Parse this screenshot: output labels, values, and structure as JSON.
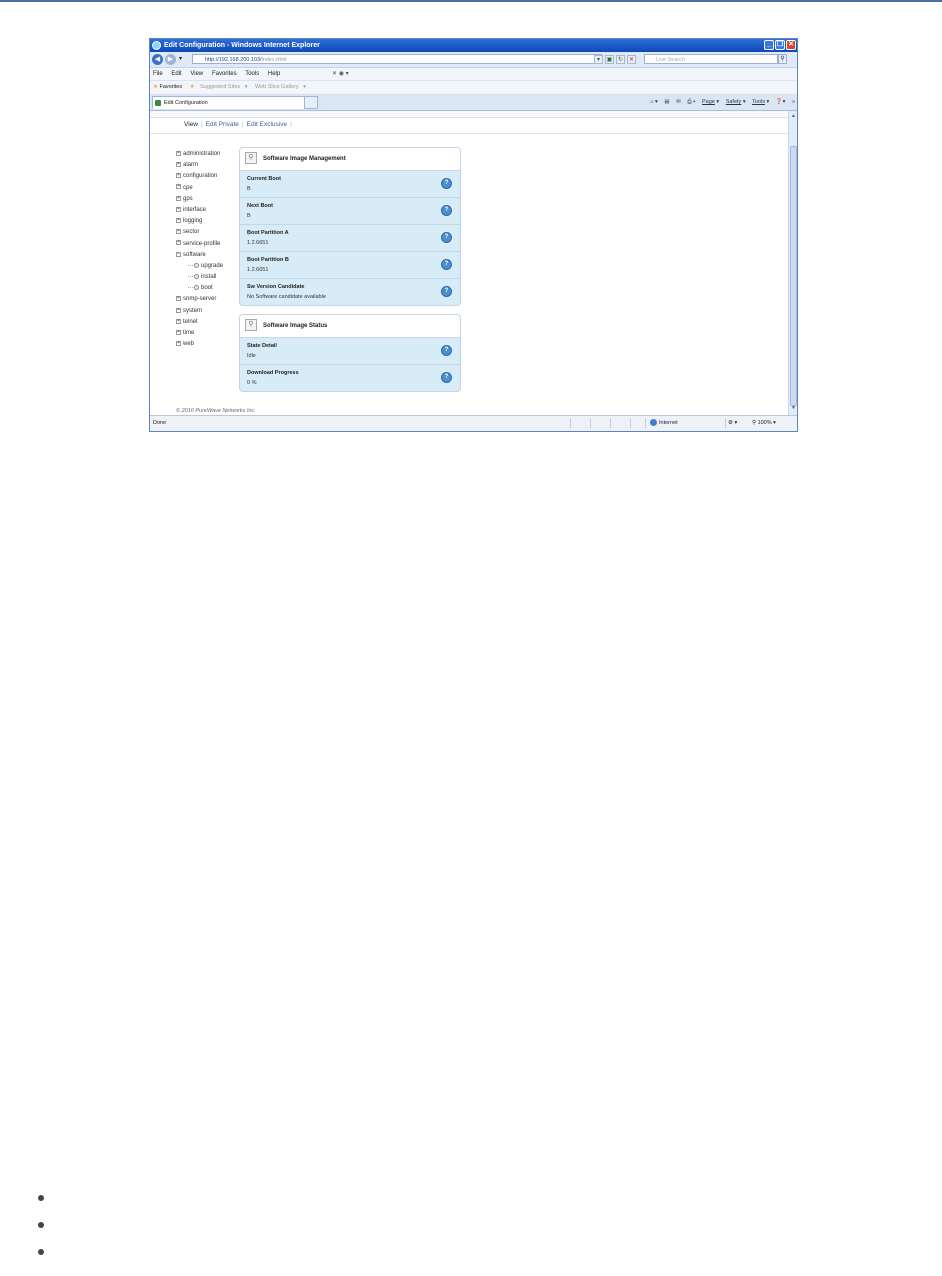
{
  "window": {
    "title": "Edit Configuration - Windows Internet Explorer",
    "minimize": "_",
    "restore": "❐",
    "close": "✕"
  },
  "address": {
    "url_main": "http://192.168.200.103/",
    "url_rest": "index.html",
    "search_placeholder": "Live Search"
  },
  "menu": [
    "File",
    "Edit",
    "View",
    "Favorites",
    "Tools",
    "Help"
  ],
  "favorites": {
    "label": "Favorites",
    "suggested": "Suggested Sites",
    "gallery": "Web Slice Gallery"
  },
  "tab": {
    "label": "Edit Configuration"
  },
  "command_bar": {
    "page": "Page",
    "safety": "Safety",
    "tools": "Tools"
  },
  "view_tabs": [
    "View",
    "Edit Private",
    "Edit Exclusive"
  ],
  "tree": {
    "top": [
      "administration",
      "alarm",
      "configuration",
      "cpe",
      "gps",
      "interface",
      "logging",
      "sector",
      "service-profile",
      "software"
    ],
    "software_children": [
      "upgrade",
      "install",
      "boot"
    ],
    "bottom": [
      "snmp-server",
      "system",
      "telnet",
      "time",
      "web"
    ]
  },
  "panels": {
    "management": {
      "title": "Software Image Management",
      "rows": [
        {
          "label": "Current Boot",
          "value": "B"
        },
        {
          "label": "Next Boot",
          "value": "B"
        },
        {
          "label": "Boot Partition A",
          "value": "1.2.6651"
        },
        {
          "label": "Boot Partition B",
          "value": "1.2.6651"
        },
        {
          "label": "Sw Version Candidate",
          "value": "No Software candidate available"
        }
      ]
    },
    "status": {
      "title": "Software Image Status",
      "rows": [
        {
          "label": "State Detail",
          "value": "Idle"
        },
        {
          "label": "Download Progress",
          "value": "0 %"
        }
      ]
    }
  },
  "copyright": "© 2010 PureWave Networks Inc.",
  "statusbar": {
    "done": "Done",
    "zone": "Internet",
    "zoom": "100%"
  },
  "colors": {
    "accent": "#2f6fd6",
    "panel_bg": "#d8ecf8",
    "help_icon": "#4a8fd0"
  }
}
